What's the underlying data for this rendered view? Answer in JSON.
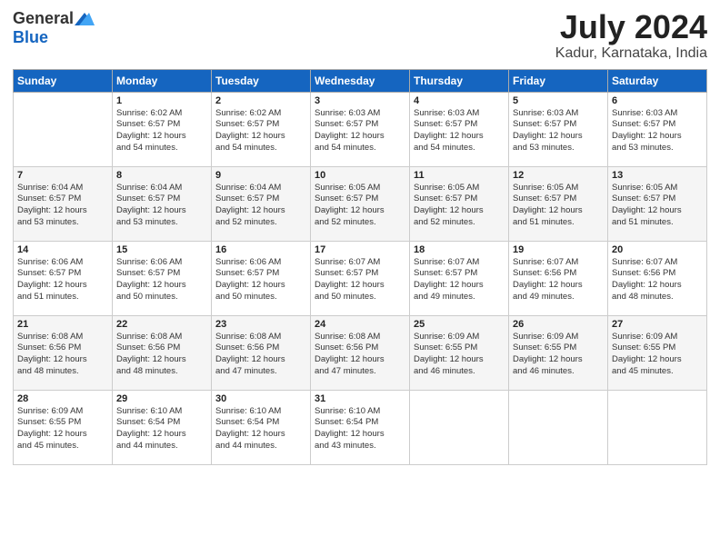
{
  "header": {
    "logo_general": "General",
    "logo_blue": "Blue",
    "title": "July 2024",
    "location": "Kadur, Karnataka, India"
  },
  "days_of_week": [
    "Sunday",
    "Monday",
    "Tuesday",
    "Wednesday",
    "Thursday",
    "Friday",
    "Saturday"
  ],
  "weeks": [
    [
      {
        "day": "",
        "detail": ""
      },
      {
        "day": "1",
        "detail": "Sunrise: 6:02 AM\nSunset: 6:57 PM\nDaylight: 12 hours\nand 54 minutes."
      },
      {
        "day": "2",
        "detail": "Sunrise: 6:02 AM\nSunset: 6:57 PM\nDaylight: 12 hours\nand 54 minutes."
      },
      {
        "day": "3",
        "detail": "Sunrise: 6:03 AM\nSunset: 6:57 PM\nDaylight: 12 hours\nand 54 minutes."
      },
      {
        "day": "4",
        "detail": "Sunrise: 6:03 AM\nSunset: 6:57 PM\nDaylight: 12 hours\nand 54 minutes."
      },
      {
        "day": "5",
        "detail": "Sunrise: 6:03 AM\nSunset: 6:57 PM\nDaylight: 12 hours\nand 53 minutes."
      },
      {
        "day": "6",
        "detail": "Sunrise: 6:03 AM\nSunset: 6:57 PM\nDaylight: 12 hours\nand 53 minutes."
      }
    ],
    [
      {
        "day": "7",
        "detail": "Sunrise: 6:04 AM\nSunset: 6:57 PM\nDaylight: 12 hours\nand 53 minutes."
      },
      {
        "day": "8",
        "detail": "Sunrise: 6:04 AM\nSunset: 6:57 PM\nDaylight: 12 hours\nand 53 minutes."
      },
      {
        "day": "9",
        "detail": "Sunrise: 6:04 AM\nSunset: 6:57 PM\nDaylight: 12 hours\nand 52 minutes."
      },
      {
        "day": "10",
        "detail": "Sunrise: 6:05 AM\nSunset: 6:57 PM\nDaylight: 12 hours\nand 52 minutes."
      },
      {
        "day": "11",
        "detail": "Sunrise: 6:05 AM\nSunset: 6:57 PM\nDaylight: 12 hours\nand 52 minutes."
      },
      {
        "day": "12",
        "detail": "Sunrise: 6:05 AM\nSunset: 6:57 PM\nDaylight: 12 hours\nand 51 minutes."
      },
      {
        "day": "13",
        "detail": "Sunrise: 6:05 AM\nSunset: 6:57 PM\nDaylight: 12 hours\nand 51 minutes."
      }
    ],
    [
      {
        "day": "14",
        "detail": "Sunrise: 6:06 AM\nSunset: 6:57 PM\nDaylight: 12 hours\nand 51 minutes."
      },
      {
        "day": "15",
        "detail": "Sunrise: 6:06 AM\nSunset: 6:57 PM\nDaylight: 12 hours\nand 50 minutes."
      },
      {
        "day": "16",
        "detail": "Sunrise: 6:06 AM\nSunset: 6:57 PM\nDaylight: 12 hours\nand 50 minutes."
      },
      {
        "day": "17",
        "detail": "Sunrise: 6:07 AM\nSunset: 6:57 PM\nDaylight: 12 hours\nand 50 minutes."
      },
      {
        "day": "18",
        "detail": "Sunrise: 6:07 AM\nSunset: 6:57 PM\nDaylight: 12 hours\nand 49 minutes."
      },
      {
        "day": "19",
        "detail": "Sunrise: 6:07 AM\nSunset: 6:56 PM\nDaylight: 12 hours\nand 49 minutes."
      },
      {
        "day": "20",
        "detail": "Sunrise: 6:07 AM\nSunset: 6:56 PM\nDaylight: 12 hours\nand 48 minutes."
      }
    ],
    [
      {
        "day": "21",
        "detail": "Sunrise: 6:08 AM\nSunset: 6:56 PM\nDaylight: 12 hours\nand 48 minutes."
      },
      {
        "day": "22",
        "detail": "Sunrise: 6:08 AM\nSunset: 6:56 PM\nDaylight: 12 hours\nand 48 minutes."
      },
      {
        "day": "23",
        "detail": "Sunrise: 6:08 AM\nSunset: 6:56 PM\nDaylight: 12 hours\nand 47 minutes."
      },
      {
        "day": "24",
        "detail": "Sunrise: 6:08 AM\nSunset: 6:56 PM\nDaylight: 12 hours\nand 47 minutes."
      },
      {
        "day": "25",
        "detail": "Sunrise: 6:09 AM\nSunset: 6:55 PM\nDaylight: 12 hours\nand 46 minutes."
      },
      {
        "day": "26",
        "detail": "Sunrise: 6:09 AM\nSunset: 6:55 PM\nDaylight: 12 hours\nand 46 minutes."
      },
      {
        "day": "27",
        "detail": "Sunrise: 6:09 AM\nSunset: 6:55 PM\nDaylight: 12 hours\nand 45 minutes."
      }
    ],
    [
      {
        "day": "28",
        "detail": "Sunrise: 6:09 AM\nSunset: 6:55 PM\nDaylight: 12 hours\nand 45 minutes."
      },
      {
        "day": "29",
        "detail": "Sunrise: 6:10 AM\nSunset: 6:54 PM\nDaylight: 12 hours\nand 44 minutes."
      },
      {
        "day": "30",
        "detail": "Sunrise: 6:10 AM\nSunset: 6:54 PM\nDaylight: 12 hours\nand 44 minutes."
      },
      {
        "day": "31",
        "detail": "Sunrise: 6:10 AM\nSunset: 6:54 PM\nDaylight: 12 hours\nand 43 minutes."
      },
      {
        "day": "",
        "detail": ""
      },
      {
        "day": "",
        "detail": ""
      },
      {
        "day": "",
        "detail": ""
      }
    ]
  ]
}
